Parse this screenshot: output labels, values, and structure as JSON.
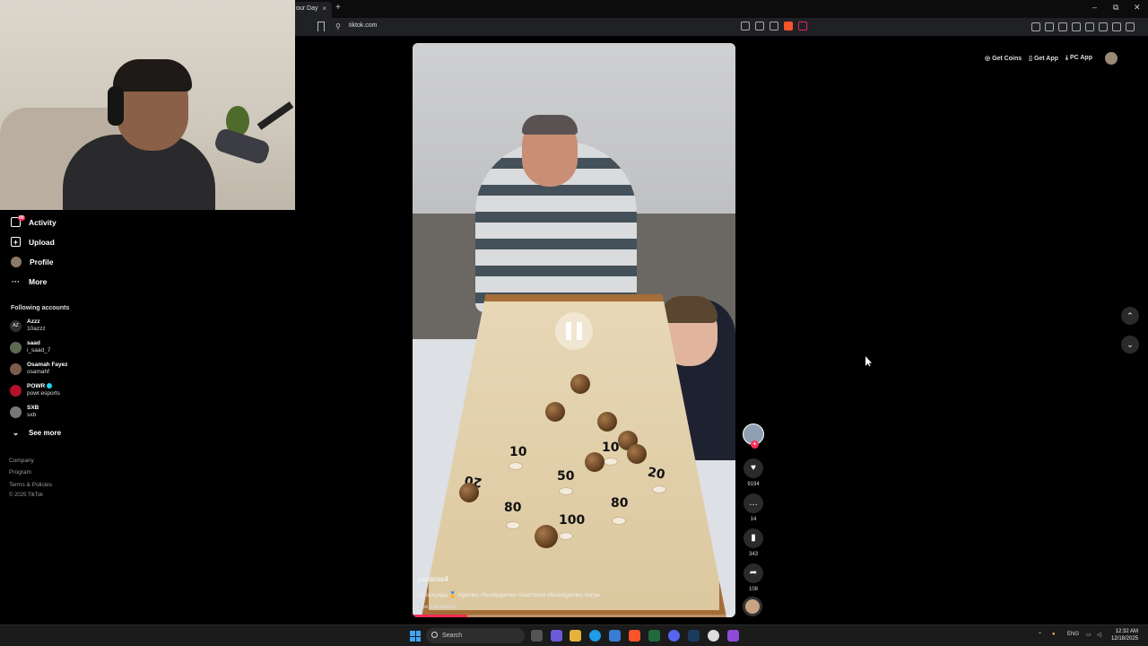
{
  "browser": {
    "tab_title": "our Day",
    "tab_close": "×",
    "new_tab": "+",
    "url": "tiktok.com",
    "window_controls": [
      "–",
      "⧉",
      "✕"
    ]
  },
  "sidebar": {
    "items": [
      {
        "label": "Activity",
        "icon": "bell-icon",
        "badge": "99"
      },
      {
        "label": "Upload",
        "icon": "plus-box-icon"
      },
      {
        "label": "Profile",
        "icon": "avatar-icon"
      },
      {
        "label": "More",
        "icon": "ellipsis-icon"
      }
    ],
    "following_title": "Following accounts",
    "accounts": [
      {
        "name": "Azzz",
        "handle": "10azzz",
        "avatar": "AZ",
        "verified": false
      },
      {
        "name": "saad",
        "handle": "i_saad_7",
        "avatar": "",
        "verified": false
      },
      {
        "name": "Osamah Fayez",
        "handle": "osamahf",
        "avatar": "",
        "verified": false
      },
      {
        "name": "POWR",
        "handle": "powr.esports",
        "avatar": "",
        "verified": true
      },
      {
        "name": "SXB",
        "handle": "sxb",
        "avatar": "",
        "verified": false
      }
    ],
    "see_more": "See more",
    "footer": [
      "Company",
      "Program",
      "Terms & Policies",
      "© 2025 TikTok"
    ]
  },
  "top_buttons": {
    "get_coins": "Get Coins",
    "get_app": "Get App",
    "pc_app": "PC App"
  },
  "video": {
    "author": "yurarus4",
    "caption": "21 секунда 🏅 #games #familygames #настолки #boardgames #игры",
    "see_translation": "See translation",
    "progress": 0.17,
    "board_scores": [
      "20",
      "10",
      "10",
      "20",
      "50",
      "80",
      "80",
      "100"
    ]
  },
  "actions": {
    "likes": "9194",
    "comments": "14",
    "saves": "343",
    "shares": "108",
    "follow_plus": "+"
  },
  "taskbar": {
    "search_placeholder": "Search",
    "lang": "ENG",
    "time": "12:32 AM",
    "date": "12/18/2025"
  },
  "colors": {
    "accent": "#fe2c55",
    "verified": "#20d5ec",
    "wood": "#a56d38"
  }
}
